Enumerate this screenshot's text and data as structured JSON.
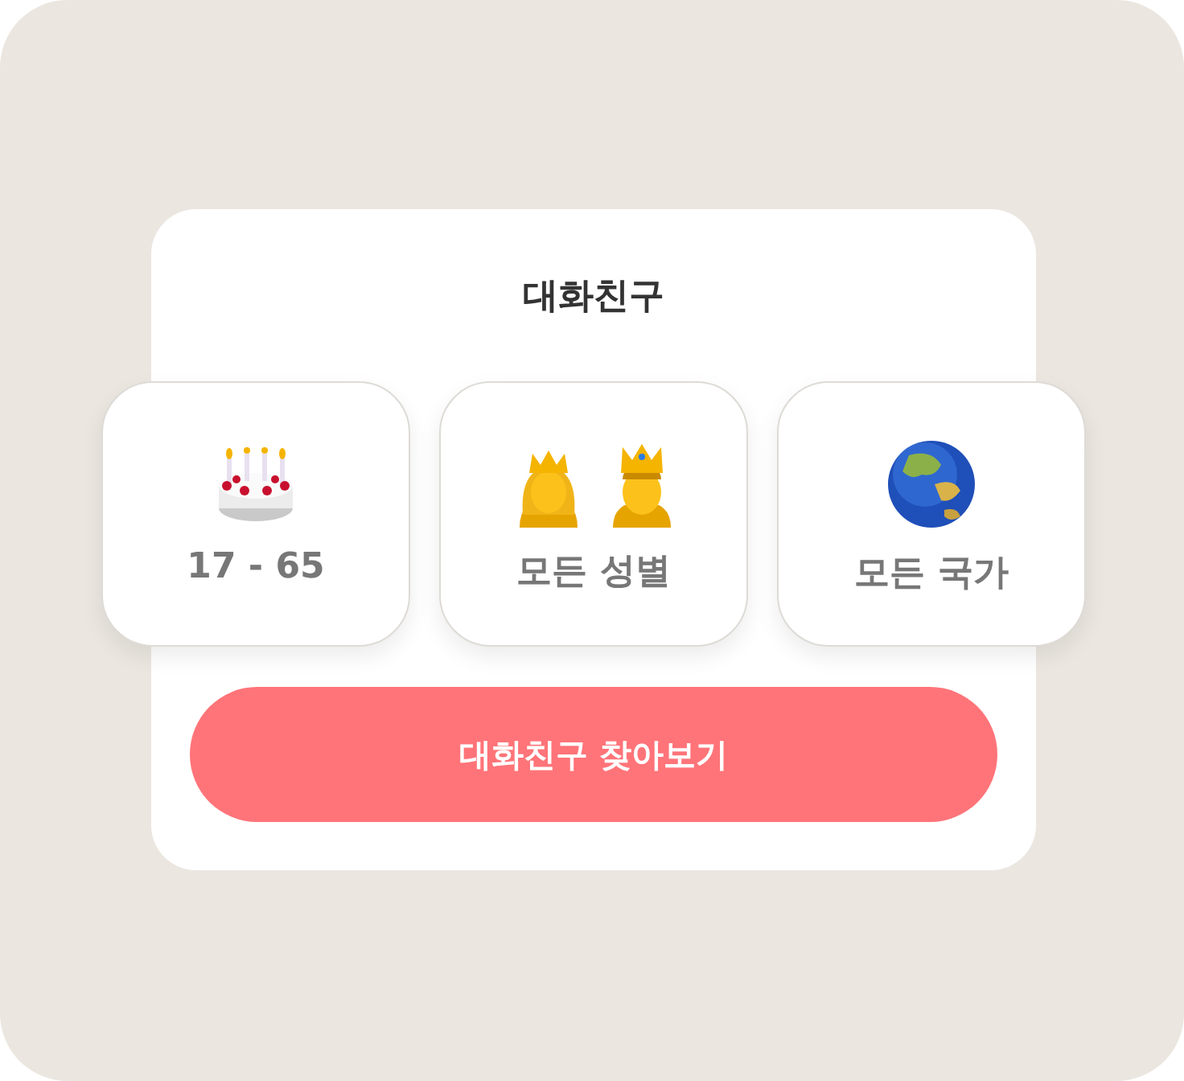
{
  "title": "대화친구",
  "filters": [
    {
      "kind": "age",
      "label": "17 - 65"
    },
    {
      "kind": "gender",
      "label": "모든 성별"
    },
    {
      "kind": "country",
      "label": "모든 국가"
    }
  ],
  "button": {
    "label": "대화친구 찾아보기"
  }
}
